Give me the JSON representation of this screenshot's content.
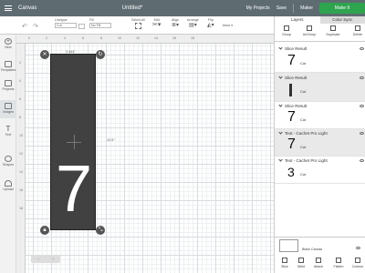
{
  "topbar": {
    "app": "Canvas",
    "document": "Untitled*",
    "my_projects": "My Projects",
    "save": "Save",
    "machine": "Maker",
    "make_it": "Make It"
  },
  "toolbar": {
    "linetype_label": "Linetype",
    "linetype_value": "Cut",
    "fill_label": "Fill",
    "fill_value": "No Fill",
    "select_all": "Select All",
    "edit": "Edit",
    "align": "Align",
    "arrange": "Arrange",
    "flip": "Flip",
    "more": "More"
  },
  "left_tools": [
    "New",
    "Templates",
    "Projects",
    "Images",
    "Text",
    "Shapes",
    "Upload"
  ],
  "ruler_top": [
    "0",
    "2",
    "4",
    "6",
    "8",
    "10",
    "12",
    "14",
    "16",
    "18"
  ],
  "ruler_left": [
    "2",
    "4",
    "6",
    "8",
    "10",
    "12",
    "14",
    "16",
    "18"
  ],
  "canvas": {
    "width_dim": "3.444\"",
    "height_dim": "12.5\"",
    "glyph": "7"
  },
  "panel": {
    "tab_layers": "Layers",
    "tab_color_sync": "Color Sync",
    "actions": [
      "Group",
      "UnGroup",
      "Duplicate",
      "Delete"
    ],
    "layers": [
      {
        "title": "Slice Result",
        "glyph": "7",
        "op": "Cut"
      },
      {
        "title": "Slice Result",
        "glyph": "I",
        "op": "Cut"
      },
      {
        "title": "Slice Result",
        "glyph": "7",
        "op": "Cut"
      },
      {
        "title": "Text - Cachet Pro Light",
        "glyph": "7",
        "op": "Cut"
      },
      {
        "title": "Text - Cachet Pro Light",
        "glyph": "3",
        "op": "Cut"
      }
    ],
    "blank_canvas": "Blank Canvas",
    "bottom_actions": [
      "Slice",
      "Weld",
      "Attach",
      "Flatten",
      "Contour"
    ]
  }
}
